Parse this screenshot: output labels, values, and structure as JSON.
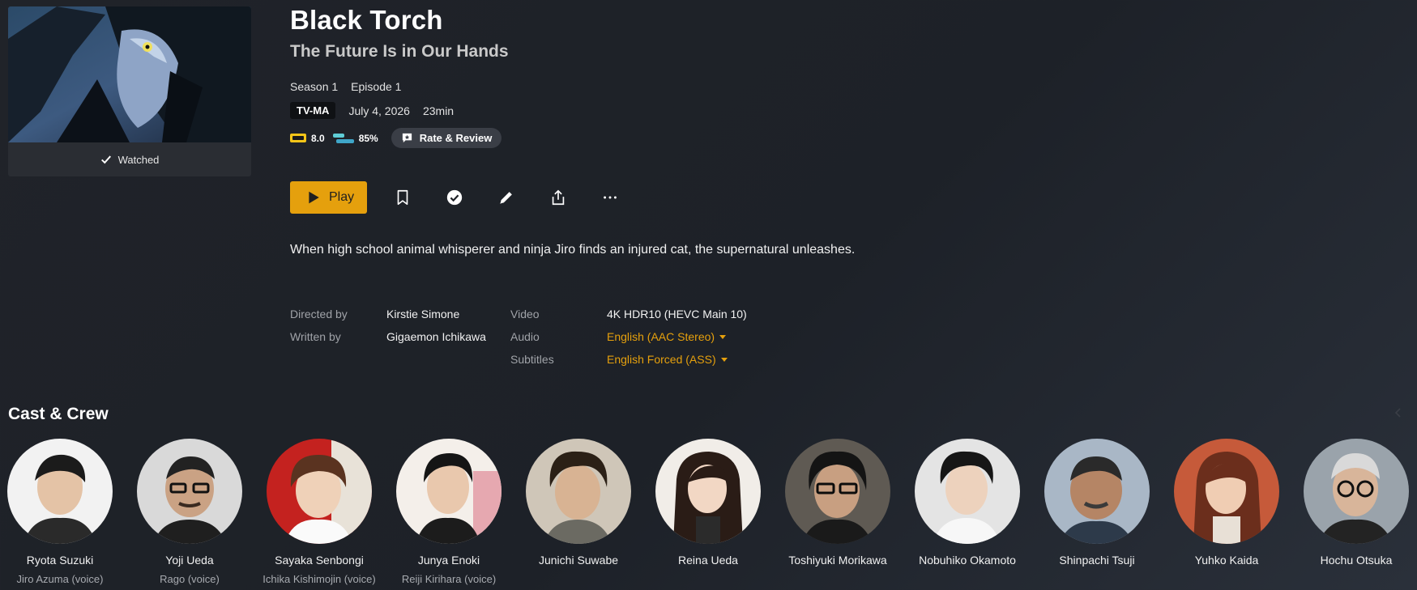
{
  "episode": {
    "show_title": "Black Torch",
    "episode_title": "The Future Is in Our Hands",
    "season": "Season 1",
    "episode": "Episode 1",
    "content_rating": "TV-MA",
    "air_date": "July 4, 2026",
    "duration": "23min",
    "watched_label": "Watched",
    "summary": "When high school animal whisperer and ninja Jiro finds an injured cat, the supernatural unleashes."
  },
  "scores": {
    "imdb": "8.0",
    "tmdb": "85%",
    "rate_label": "Rate & Review"
  },
  "actions": {
    "play_label": "Play",
    "icons": [
      "bookmark-icon",
      "check-circle-icon",
      "pencil-icon",
      "share-icon",
      "more-icon"
    ]
  },
  "credits": {
    "directed_label": "Directed by",
    "directed_value": "Kirstie Simone",
    "written_label": "Written by",
    "written_value": "Gigaemon Ichikawa"
  },
  "media": {
    "video_label": "Video",
    "video_value": "4K HDR10 (HEVC Main 10)",
    "audio_label": "Audio",
    "audio_value": "English (AAC Stereo)",
    "subtitles_label": "Subtitles",
    "subtitles_value": "English Forced (ASS)"
  },
  "cast_heading": "Cast & Crew",
  "cast": [
    {
      "name": "Ryota Suzuki",
      "role": "Jiro Azuma (voice)"
    },
    {
      "name": "Yoji Ueda",
      "role": "Rago (voice)"
    },
    {
      "name": "Sayaka Senbongi",
      "role": "Ichika Kishimojin (voice)"
    },
    {
      "name": "Junya Enoki",
      "role": "Reiji Kirihara (voice)"
    },
    {
      "name": "Junichi Suwabe",
      "role": ""
    },
    {
      "name": "Reina Ueda",
      "role": ""
    },
    {
      "name": "Toshiyuki Morikawa",
      "role": ""
    },
    {
      "name": "Nobuhiko Okamoto",
      "role": ""
    },
    {
      "name": "Shinpachi Tsuji",
      "role": ""
    },
    {
      "name": "Yuhko Kaida",
      "role": ""
    },
    {
      "name": "Hochu Otsuka",
      "role": ""
    }
  ],
  "colors": {
    "accent": "#e5a00d",
    "background": "#202329"
  }
}
